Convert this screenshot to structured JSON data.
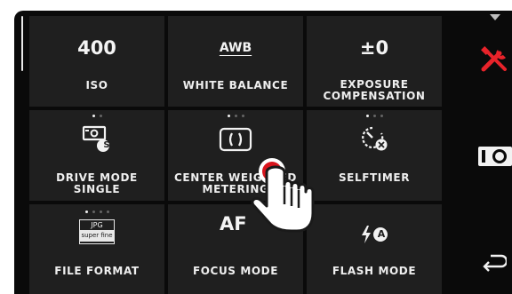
{
  "menu": {
    "tiles": [
      {
        "value": "400",
        "label": "ISO"
      },
      {
        "value": "AWB",
        "label": "WHITE BALANCE"
      },
      {
        "value": "±0",
        "label_line1": "EXPOSURE",
        "label_line2": "COMPENSATION"
      },
      {
        "label_line1": "DRIVE MODE",
        "label_line2": "SINGLE",
        "badge": "S"
      },
      {
        "label_line1": "CENTER WEIGHTED",
        "label_line2": "METERING",
        "value": "( )"
      },
      {
        "label": "SELFTIMER"
      },
      {
        "jpg_top": "JPG",
        "jpg_bottom": "super fine",
        "label": "FILE FORMAT"
      },
      {
        "value": "AF",
        "label": "FOCUS MODE"
      },
      {
        "label": "FLASH MODE",
        "flash_badge": "A"
      }
    ]
  },
  "sidebar": {
    "icons": [
      "chevron-down-icon",
      "tools-icon",
      "camera-icon",
      "back-arrow-icon"
    ],
    "accent_color": "#e8232a"
  },
  "touch_indicator": {
    "icon": "hand-pointer-icon",
    "color": "#d9141c"
  }
}
